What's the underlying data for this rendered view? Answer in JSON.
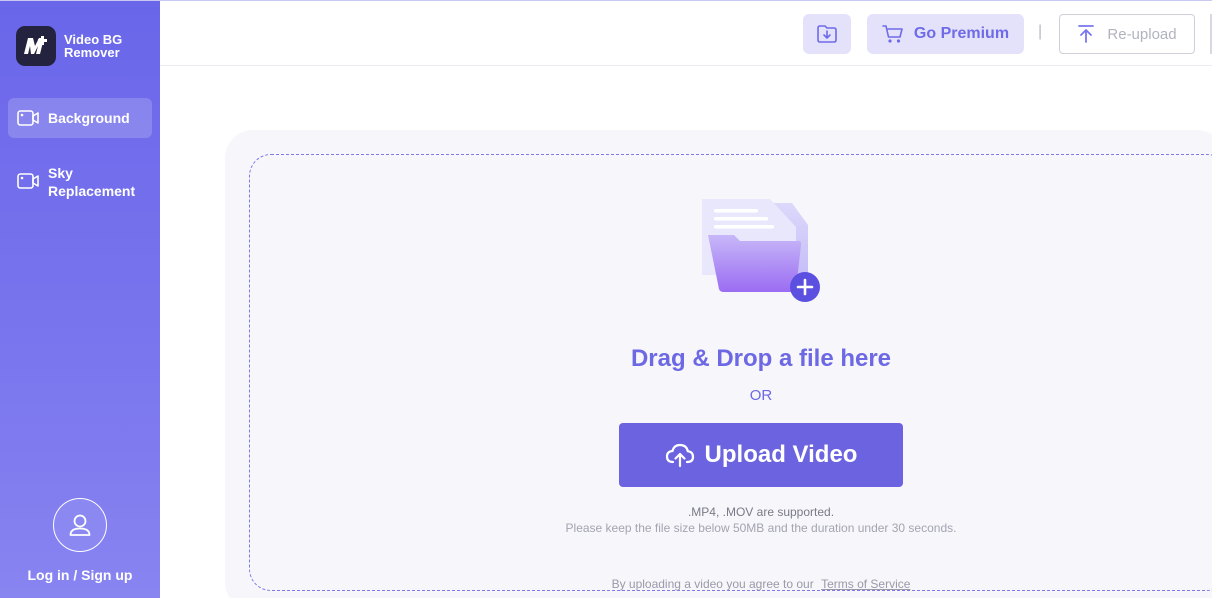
{
  "app": {
    "name_line1": "Video BG",
    "name_line2": "Remover"
  },
  "sidebar": {
    "items": [
      {
        "label": "Background",
        "icon": "video-camera-icon",
        "active": true
      },
      {
        "label": "Sky Replacement",
        "icon": "video-camera-icon",
        "active": false
      }
    ],
    "login_label": "Log in / Sign up"
  },
  "topbar": {
    "premium_label": "Go Premium",
    "divider": "|",
    "reupload_label": "Re-upload"
  },
  "upload": {
    "title": "Drag & Drop a file here",
    "or": "OR",
    "button_label": "Upload Video",
    "formats": ".MP4, .MOV are supported.",
    "limits": "Please keep the file size below 50MB and the duration under 30 seconds.",
    "terms_prefix": "By uploading a video you agree to our",
    "terms_link": "Terms of Service"
  },
  "colors": {
    "accent": "#6c63e0",
    "sidebar": "#6a66ea",
    "premium_bg": "#e4e2fb"
  }
}
